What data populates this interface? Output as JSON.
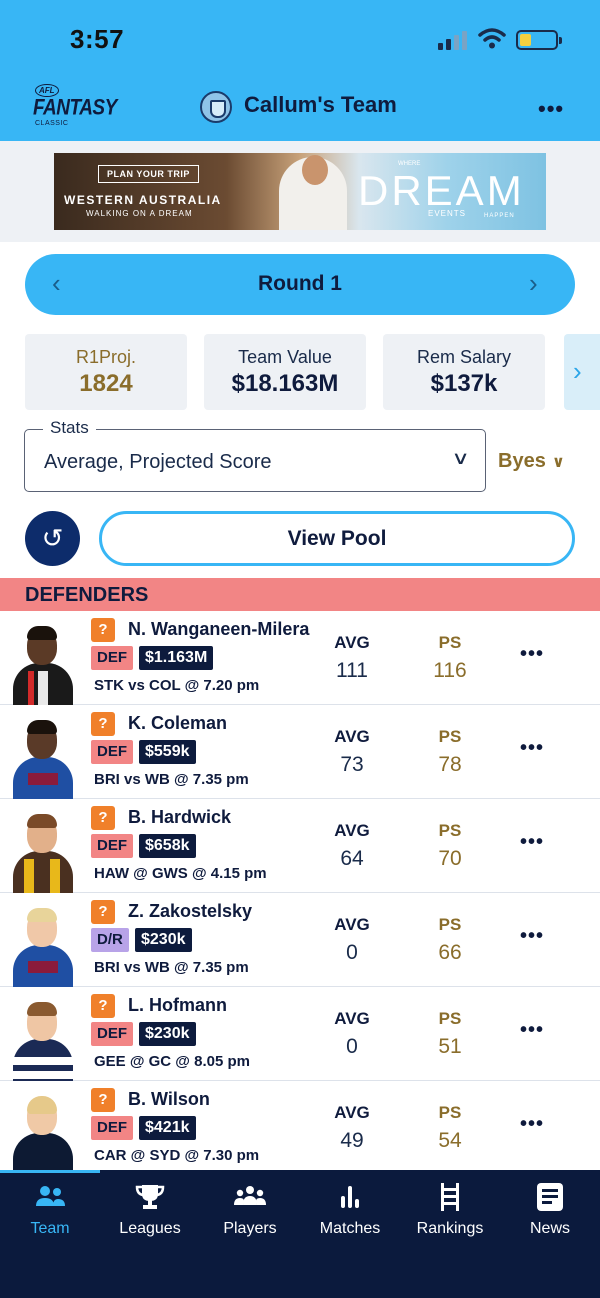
{
  "status_bar": {
    "time": "3:57"
  },
  "header": {
    "logo": {
      "badge": "AFL",
      "wordmark": "FANTASY",
      "sub": "CLASSIC"
    },
    "title": "Callum's Team",
    "more_icon": "ellipsis-icon"
  },
  "ad": {
    "plan": "PLAN YOUR TRIP",
    "line1": "WESTERN AUSTRALIA",
    "line2": "WALKING ON A DREAM",
    "where": "WHERE",
    "headline": "DREAM",
    "events": "EVENTS",
    "happen": "HAPPEN"
  },
  "round": {
    "label": "Round 1",
    "prev_icon": "chevron-left-icon",
    "next_icon": "chevron-right-icon"
  },
  "stats_cards": [
    {
      "title": "R1Proj.",
      "value": "1824"
    },
    {
      "title": "Team Value",
      "value": "$18.163M"
    },
    {
      "title": "Rem Salary",
      "value": "$137k"
    }
  ],
  "stats_filter": {
    "legend": "Stats",
    "value": "Average, Projected Score"
  },
  "byes": {
    "label": "Byes"
  },
  "view_pool": {
    "label": "View Pool"
  },
  "section": {
    "title": "DEFENDERS"
  },
  "players": [
    {
      "name": "N. Wanganeen-Milera",
      "status": "?",
      "position": "DEF",
      "price": "$1.163M",
      "fixture": "STK vs COL @ 7.20 pm",
      "avg_label": "AVG",
      "avg": "111",
      "ps_label": "PS",
      "ps": "116"
    },
    {
      "name": "K. Coleman",
      "status": "?",
      "position": "DEF",
      "price": "$559k",
      "fixture": "BRI vs WB @ 7.35 pm",
      "avg_label": "AVG",
      "avg": "73",
      "ps_label": "PS",
      "ps": "78"
    },
    {
      "name": "B. Hardwick",
      "status": "?",
      "position": "DEF",
      "price": "$658k",
      "fixture": "HAW @ GWS @ 4.15 pm",
      "avg_label": "AVG",
      "avg": "64",
      "ps_label": "PS",
      "ps": "70"
    },
    {
      "name": "Z. Zakostelsky",
      "status": "?",
      "position": "D/R",
      "price": "$230k",
      "fixture": "BRI vs WB @ 7.35 pm",
      "avg_label": "AVG",
      "avg": "0",
      "ps_label": "PS",
      "ps": "66"
    },
    {
      "name": "L. Hofmann",
      "status": "?",
      "position": "DEF",
      "price": "$230k",
      "fixture": "GEE @ GC @ 8.05 pm",
      "avg_label": "AVG",
      "avg": "0",
      "ps_label": "PS",
      "ps": "51"
    },
    {
      "name": "B. Wilson",
      "status": "?",
      "position": "DEF",
      "price": "$421k",
      "fixture": "CAR @ SYD @ 7.30 pm",
      "avg_label": "AVG",
      "avg": "49",
      "ps_label": "PS",
      "ps": "54"
    }
  ],
  "tabs": [
    {
      "label": "Team",
      "icon": "team-icon"
    },
    {
      "label": "Leagues",
      "icon": "trophy-icon"
    },
    {
      "label": "Players",
      "icon": "players-icon"
    },
    {
      "label": "Matches",
      "icon": "bar-chart-icon"
    },
    {
      "label": "Rankings",
      "icon": "ladder-icon"
    },
    {
      "label": "News",
      "icon": "news-icon"
    }
  ],
  "colors": {
    "accent": "#38b6f5",
    "navy": "#0b1a3d",
    "gold": "#8a6d2b",
    "def": "#f28585",
    "dr": "#b8a3e8",
    "status": "#f0802a"
  }
}
